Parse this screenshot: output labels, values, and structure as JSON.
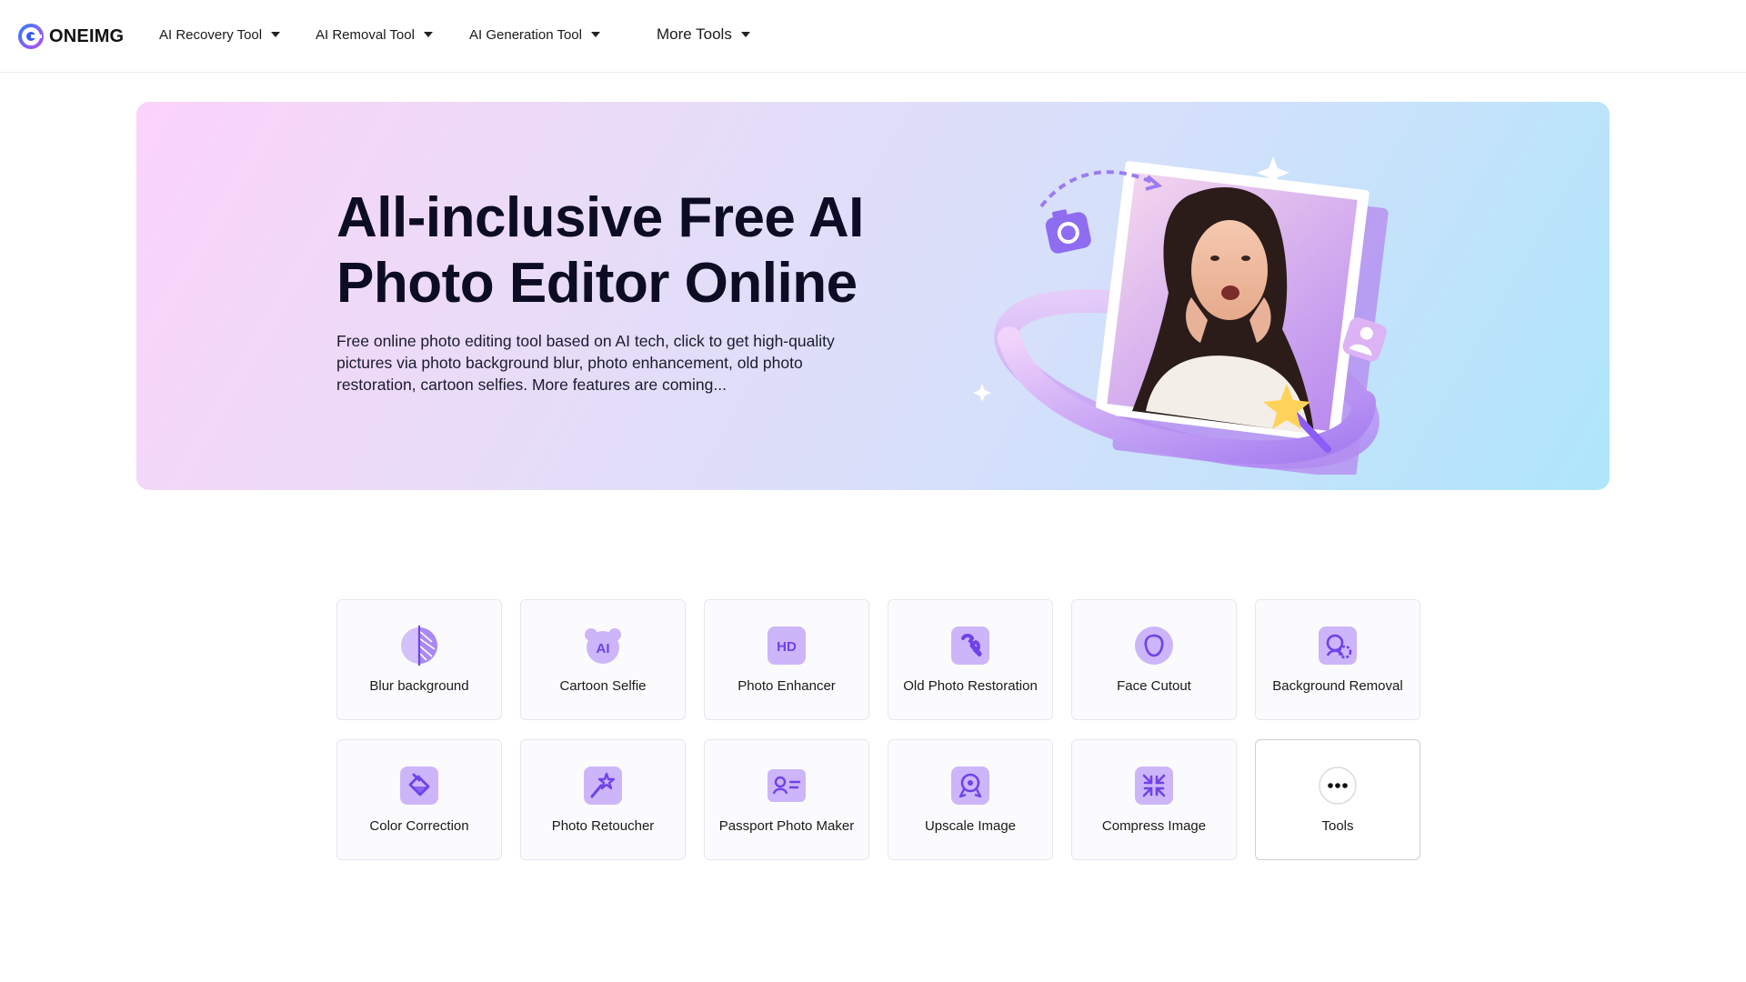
{
  "header": {
    "logo_text": "ONEIMG",
    "nav": [
      {
        "label": "AI Recovery Tool",
        "icon": "caret-down-icon"
      },
      {
        "label": "AI Removal Tool",
        "icon": "caret-down-icon"
      },
      {
        "label": "AI Generation Tool",
        "icon": "caret-down-icon"
      },
      {
        "label": "More Tools",
        "icon": "caret-down-icon"
      }
    ]
  },
  "hero": {
    "title": "All-inclusive Free AI Photo Editor Online",
    "description": "Free online photo editing tool based on AI tech, click to get high-quality pictures via photo background blur, photo enhancement, old photo restoration, cartoon selfies. More features are coming..."
  },
  "tools": [
    {
      "label": "Blur background",
      "icon": "blur-icon"
    },
    {
      "label": "Cartoon Selfie",
      "icon": "cartoon-ai-icon"
    },
    {
      "label": "Photo Enhancer",
      "icon": "hd-icon"
    },
    {
      "label": "Old Photo Restoration",
      "icon": "wrench-icon"
    },
    {
      "label": "Face Cutout",
      "icon": "face-icon"
    },
    {
      "label": "Background Removal",
      "icon": "background-removal-icon"
    },
    {
      "label": "Color Correction",
      "icon": "paint-bucket-icon"
    },
    {
      "label": "Photo Retoucher",
      "icon": "magic-wand-icon"
    },
    {
      "label": "Passport Photo Maker",
      "icon": "id-card-icon"
    },
    {
      "label": "Upscale Image",
      "icon": "upscale-icon"
    },
    {
      "label": "Compress Image",
      "icon": "compress-icon"
    },
    {
      "label": "Tools",
      "icon": "more-dots-icon"
    }
  ],
  "colors": {
    "accent": "#7b4ff0",
    "icon_bg": "#d7c4fb",
    "hero_gradient_start": "#fbd3fa",
    "hero_gradient_end": "#aee6fb"
  }
}
